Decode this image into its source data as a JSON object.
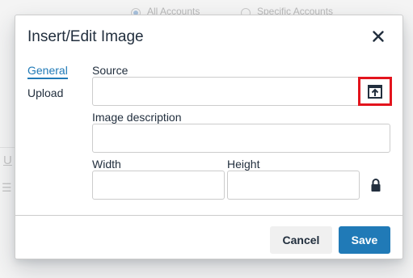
{
  "background": {
    "radio_all_label": "All Accounts",
    "radio_specific_label": "Specific Accounts",
    "underline_glyph": "U",
    "list_glyph": "☰"
  },
  "dialog": {
    "title": "Insert/Edit Image",
    "close_icon": "close-icon",
    "tabs": [
      {
        "label": "General",
        "active": true
      },
      {
        "label": "Upload",
        "active": false
      }
    ],
    "fields": {
      "source": {
        "label": "Source",
        "value": "",
        "browse_icon": "browse-upload-icon"
      },
      "description": {
        "label": "Image description",
        "value": ""
      },
      "width": {
        "label": "Width",
        "value": ""
      },
      "height": {
        "label": "Height",
        "value": ""
      },
      "constrain_icon": "lock-icon"
    },
    "buttons": {
      "cancel": "Cancel",
      "save": "Save"
    }
  },
  "colors": {
    "accent": "#207ab7",
    "highlight_box": "#e3141d",
    "text": "#222f3e",
    "border": "#cccccc"
  }
}
